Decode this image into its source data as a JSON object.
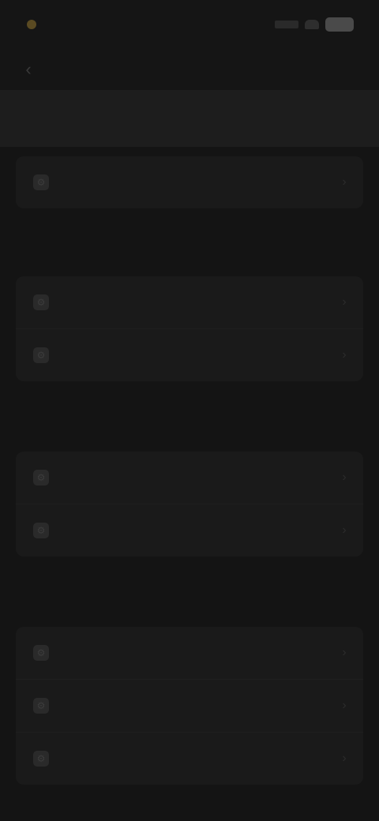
{
  "status_bar": {
    "time": ""
  },
  "nav": {
    "back_glyph": "‹",
    "title": ""
  },
  "top_section": {
    "title": ""
  },
  "groups": [
    {
      "label": "",
      "rows": [
        {
          "label": ""
        },
        {
          "label": ""
        }
      ]
    },
    {
      "label": "",
      "rows": [
        {
          "label": ""
        },
        {
          "label": ""
        }
      ]
    },
    {
      "label": "",
      "rows": [
        {
          "label": ""
        },
        {
          "label": ""
        },
        {
          "label": ""
        }
      ]
    }
  ],
  "first_card": {
    "rows": [
      {
        "label": ""
      }
    ]
  },
  "colors": {
    "background": "#141414",
    "card": "#1a1a1a",
    "accent": "#c9a44a"
  },
  "icons": {
    "back": "chevron-left-icon",
    "row": "settings-icon",
    "chevron": "chevron-right-icon"
  }
}
